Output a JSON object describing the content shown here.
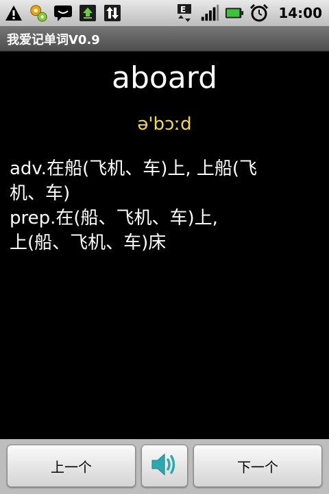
{
  "status_bar": {
    "time": "14:00",
    "icons": [
      "warning-icon",
      "settings-gears-icon",
      "chat-icon",
      "upload-icon",
      "data-transfer-icon",
      "edge-network-icon",
      "signal-icon",
      "battery-icon",
      "alarm-icon"
    ],
    "network_label": "E"
  },
  "app": {
    "title": "我爱记单词V0.9"
  },
  "word": {
    "text": "aboard",
    "phonetic": "ə'bɔːd",
    "definition": "adv.在船(飞机、车)上, 上船(飞\n机、车)\nprep.在(船、飞机、车)上,\n上(船、飞机、车)床"
  },
  "buttons": {
    "prev_label": "上一个",
    "next_label": "下一个",
    "sound_icon": "speaker-icon"
  },
  "colors": {
    "phonetic": "#f0d84a",
    "speaker": "#2aa9b0",
    "background": "#000000"
  }
}
